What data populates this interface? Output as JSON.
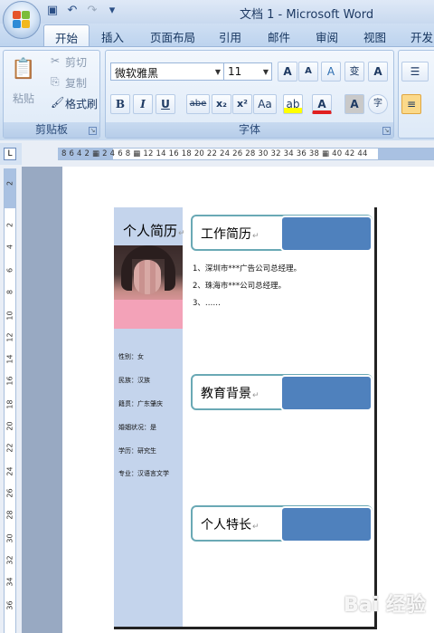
{
  "window": {
    "title": "文档 1 - Microsoft Word"
  },
  "qat": {
    "icons": [
      "save-icon",
      "undo-icon",
      "redo-icon",
      "customize-icon"
    ]
  },
  "tabs": [
    "开始",
    "插入",
    "页面布局",
    "引用",
    "邮件",
    "审阅",
    "视图",
    "开发"
  ],
  "active_tab": "开始",
  "clipboard": {
    "paste": "粘贴",
    "cut": "剪切",
    "copy": "复制",
    "format_painter": "格式刷",
    "group_label": "剪贴板"
  },
  "font": {
    "name": "微软雅黑",
    "size": "11",
    "group_label": "字体",
    "bold": "B",
    "italic": "I",
    "underline": "U",
    "strike": "abe",
    "subscript": "x₂",
    "superscript": "x²",
    "change_case": "Aa",
    "grow": "A",
    "shrink": "A",
    "clear": "A",
    "phonetic": "变",
    "border_char": "A",
    "shading": "A",
    "enclose": "字"
  },
  "ruler": {
    "h_numbers": "8  6  4  2  ▦  2  4  6  8  ▦  12  14  16  18  20  22  24  26  28  30  32  34  36  38 ▦ 40  42  44",
    "v_numbers": [
      "2",
      "2",
      "4",
      "6",
      "8",
      "10",
      "12",
      "14",
      "16",
      "18",
      "20",
      "22",
      "24",
      "26",
      "28",
      "30",
      "32",
      "34",
      "36"
    ]
  },
  "resume": {
    "title": "个人简历",
    "info": [
      "性别：女",
      "民族：汉族",
      "籍贯：广东肇庆",
      "婚姻状况：是",
      "学历：研究生",
      "专业：汉语言文学"
    ],
    "sections": [
      "工作简历",
      "教育背景",
      "个人特长"
    ],
    "work_items": [
      "1、深圳市***广告公司总经理。",
      "2、珠海市***公司总经理。",
      "3、……"
    ]
  },
  "watermark": "Bai 经验"
}
